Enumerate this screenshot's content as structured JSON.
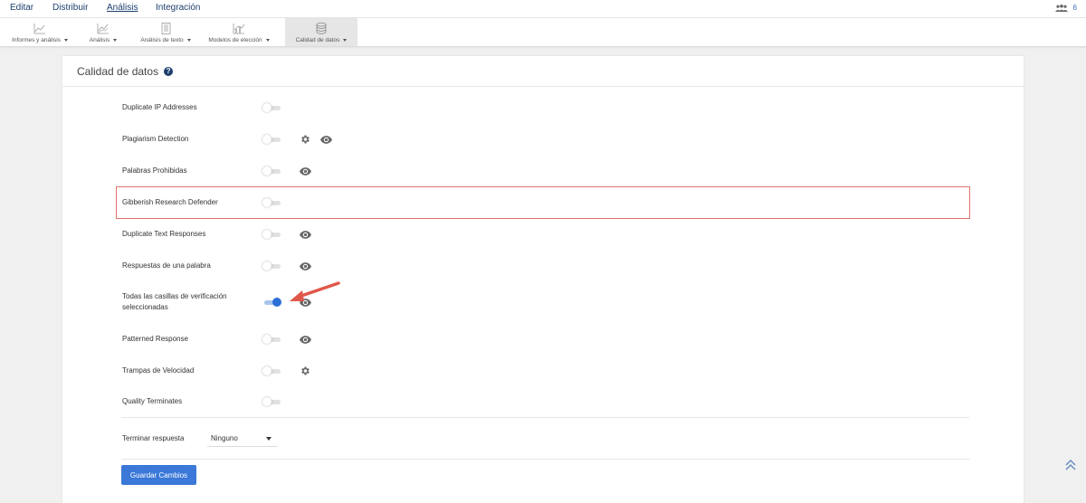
{
  "topnav": {
    "items": [
      {
        "label": "Editar",
        "active": false
      },
      {
        "label": "Distribuir",
        "active": false
      },
      {
        "label": "Análisis",
        "active": true
      },
      {
        "label": "Integración",
        "active": false
      }
    ],
    "user_count": "6"
  },
  "subnav": {
    "tabs": [
      {
        "label": "Informes y análisis",
        "icon": "line-chart-icon",
        "active": false
      },
      {
        "label": "Análisis",
        "icon": "trend-chart-icon",
        "active": false
      },
      {
        "label": "Análisis de texto",
        "icon": "document-grid-icon",
        "active": false
      },
      {
        "label": "Modelos de elección",
        "icon": "bar-line-chart-icon",
        "active": false
      },
      {
        "label": "Calidad de datos",
        "icon": "database-icon",
        "active": true
      }
    ]
  },
  "card": {
    "title": "Calidad de datos",
    "help_icon": "question-circle-icon"
  },
  "settings": [
    {
      "label": "Duplicate IP Addresses",
      "enabled": false,
      "icons": []
    },
    {
      "label": "Plagiarism Detection",
      "enabled": false,
      "icons": [
        "gear-icon",
        "eye-icon"
      ]
    },
    {
      "label": "Palabras Prohibidas",
      "enabled": false,
      "icons": [
        "eye-icon"
      ]
    },
    {
      "label": "Gibberish Research Defender",
      "enabled": false,
      "icons": [],
      "highlighted": true
    },
    {
      "label": "Duplicate Text Responses",
      "enabled": false,
      "icons": [
        "eye-icon"
      ]
    },
    {
      "label": "Respuestas de una palabra",
      "enabled": false,
      "icons": [
        "eye-icon"
      ]
    },
    {
      "label": "Todas las casillas de verificación seleccionadas",
      "enabled": true,
      "icons": [
        "eye-icon"
      ]
    },
    {
      "label": "Patterned Response",
      "enabled": false,
      "icons": [
        "eye-icon"
      ]
    },
    {
      "label": "Trampas de Velocidad",
      "enabled": false,
      "icons": [
        "gear-icon"
      ]
    },
    {
      "label": "Quality Terminates",
      "enabled": false,
      "icons": []
    }
  ],
  "terminate": {
    "label": "Terminar respuesta",
    "value": "Ninguno"
  },
  "save_label": "Guardar Cambios",
  "colors": {
    "accent": "#3b78d8",
    "nav_text": "#1c3e6e",
    "highlight_border": "#e07368",
    "annotation_arrow": "#e0584a"
  }
}
